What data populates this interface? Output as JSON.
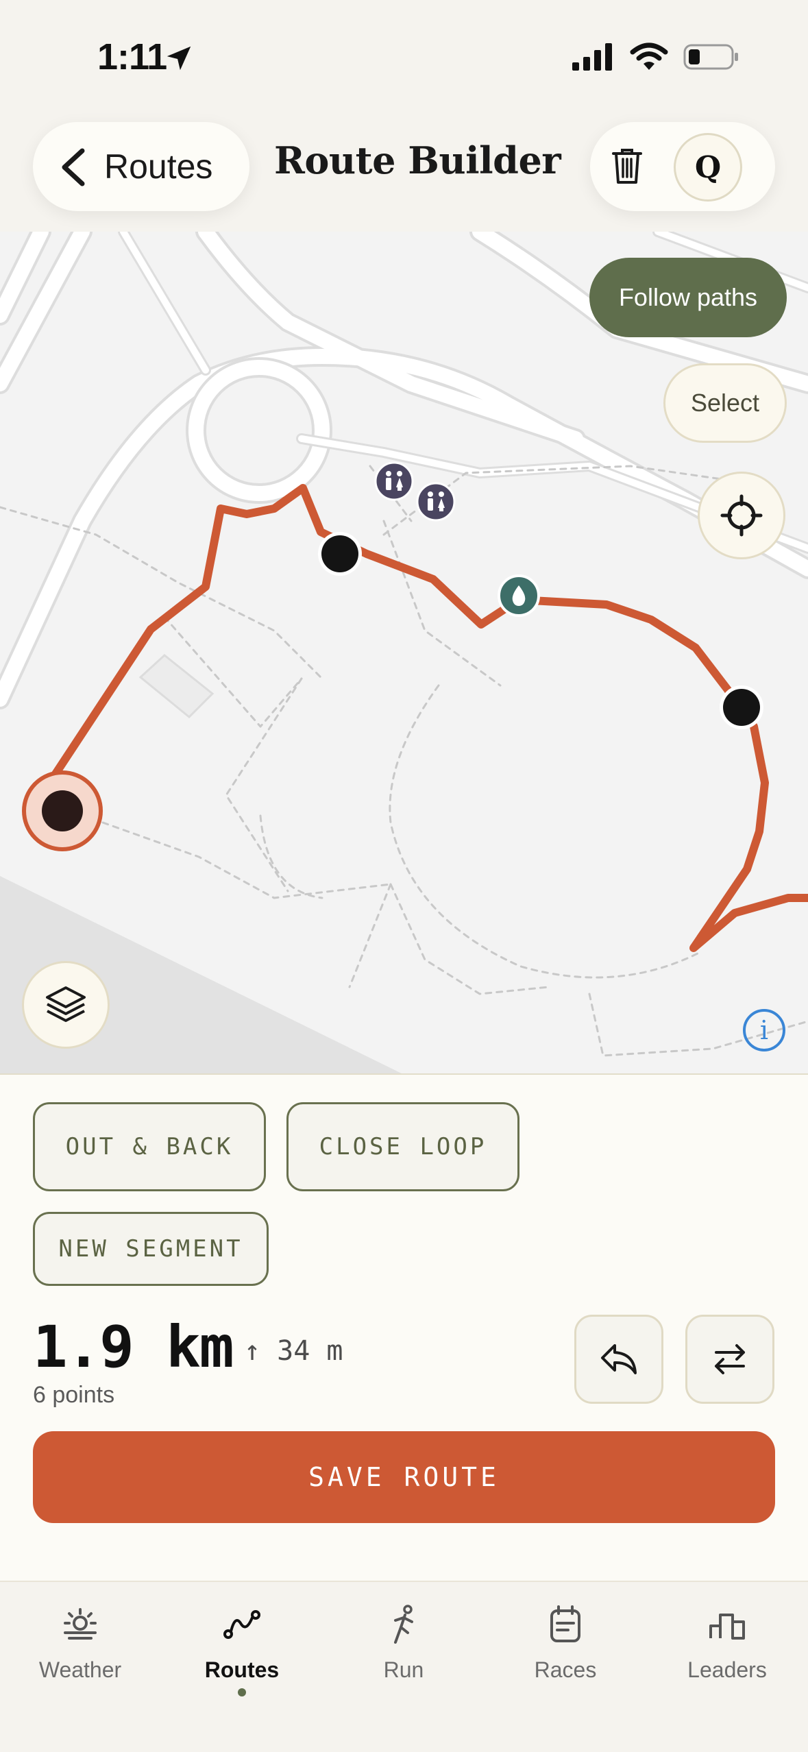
{
  "status_bar": {
    "time": "1:11"
  },
  "header": {
    "back_label": "Routes",
    "title": "Route Builder",
    "avatar_letter": "Q"
  },
  "map": {
    "follow_paths_label": "Follow paths",
    "select_label": "Select",
    "info_label": "i",
    "route_color": "#cd5934"
  },
  "sheet": {
    "out_and_back_label": "OUT & BACK",
    "close_loop_label": "CLOSE LOOP",
    "new_segment_label": "NEW SEGMENT",
    "distance": "1.9 km",
    "elevation": "↑ 34 m",
    "points": "6 points",
    "save_label": "SAVE ROUTE",
    "accent": "#cd5934",
    "olive": "#5f6e4c"
  },
  "tabs": [
    {
      "label": "Weather",
      "icon": "sun-horizon-icon",
      "active": false
    },
    {
      "label": "Routes",
      "icon": "route-icon",
      "active": true
    },
    {
      "label": "Run",
      "icon": "runner-icon",
      "active": false
    },
    {
      "label": "Races",
      "icon": "calendar-icon",
      "active": false
    },
    {
      "label": "Leaders",
      "icon": "leaderboard-icon",
      "active": false
    }
  ]
}
